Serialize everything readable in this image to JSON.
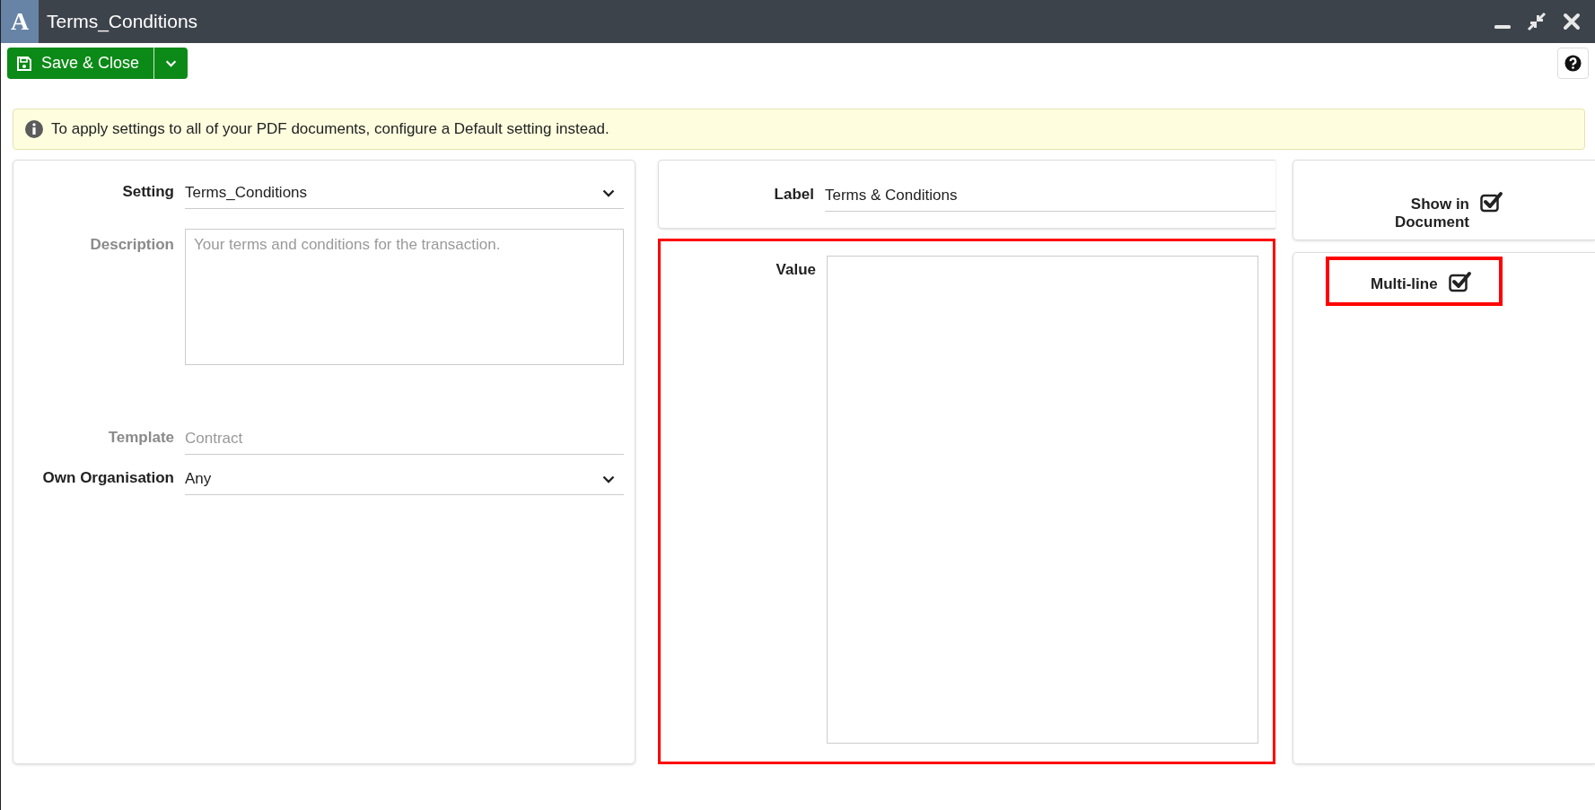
{
  "window": {
    "title": "Terms_Conditions",
    "logo": "A"
  },
  "toolbar": {
    "save_button": "Save & Close"
  },
  "info": {
    "text": "To apply settings to all of your PDF documents, configure a Default setting instead."
  },
  "left_panel": {
    "fields": [
      {
        "kind": "dropdown",
        "label": "Setting",
        "value": "Terms_Conditions",
        "disabled": false
      },
      {
        "kind": "textarea",
        "label": "Description",
        "placeholder": "Your terms and conditions for the transaction.",
        "disabled": true
      },
      {
        "kind": "text",
        "label": "Template",
        "value": "Contract",
        "disabled": true
      },
      {
        "kind": "dropdown",
        "label": "Own Organisation",
        "value": "Any",
        "disabled": false
      }
    ]
  },
  "label_field": {
    "label": "Label",
    "value": "Terms & Conditions"
  },
  "value_field": {
    "label": "Value",
    "highlighted": true
  },
  "options": [
    {
      "label": "Show in Document",
      "checked": true,
      "highlighted": false
    },
    {
      "label": "Multi-line",
      "checked": true,
      "highlighted": true
    }
  ]
}
